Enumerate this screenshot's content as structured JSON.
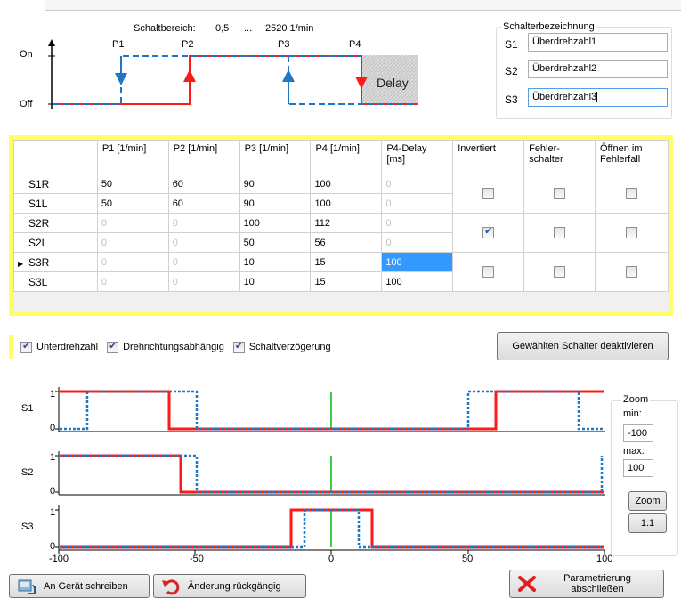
{
  "diagram": {
    "range_label": "Schaltbereich:",
    "range_min": "0,5",
    "range_sep": "...",
    "range_max": "2520 1/min",
    "on_label": "On",
    "off_label": "Off",
    "points": [
      "P1",
      "P2",
      "P3",
      "P4"
    ],
    "delay_label": "Delay"
  },
  "switch_names": {
    "title": "Schalterbezeichnung",
    "rows": [
      {
        "label": "S1",
        "value": "Überdrehzahl1"
      },
      {
        "label": "S2",
        "value": "Überdrehzahl2"
      },
      {
        "label": "S3",
        "value": "Überdrehzahl3"
      }
    ]
  },
  "grid": {
    "columns": [
      "",
      "P1 [1/min]",
      "P2 [1/min]",
      "P3 [1/min]",
      "P4 [1/min]",
      "P4-Delay [ms]",
      "Invertiert",
      "Fehler-schalter",
      "Öffnen im Fehlerfall"
    ],
    "rows": [
      {
        "name": "S1R",
        "p1": "50",
        "p2": "60",
        "p3": "90",
        "p4": "100",
        "delay": "0"
      },
      {
        "name": "S1L",
        "p1": "50",
        "p2": "60",
        "p3": "90",
        "p4": "100",
        "delay": "0"
      },
      {
        "name": "S2R",
        "p1": "0",
        "p2": "0",
        "p3": "100",
        "p4": "112",
        "delay": "0"
      },
      {
        "name": "S2L",
        "p1": "0",
        "p2": "0",
        "p3": "50",
        "p4": "56",
        "delay": "0"
      },
      {
        "name": "S3R",
        "p1": "0",
        "p2": "0",
        "p3": "10",
        "p4": "15",
        "delay": "100"
      },
      {
        "name": "S3L",
        "p1": "0",
        "p2": "0",
        "p3": "10",
        "p4": "15",
        "delay": "100"
      }
    ],
    "groups": [
      {
        "invertiert": false,
        "fehlerschalter": false,
        "oeffnen": false
      },
      {
        "invertiert": true,
        "fehlerschalter": false,
        "oeffnen": false
      },
      {
        "invertiert": false,
        "fehlerschalter": false,
        "oeffnen": false
      }
    ]
  },
  "options": {
    "unterdrehzahl": "Unterdrehzahl",
    "drehrichtung": "Drehrichtungsabhängig",
    "schaltverzoegerung": "Schaltverzögerung"
  },
  "deactivate_button": "Gewählten Schalter deaktivieren",
  "plots": {
    "rows": [
      "S1",
      "S2",
      "S3"
    ],
    "y_ticks": [
      "1",
      "0"
    ],
    "x_ticks": [
      "-100",
      "-50",
      "0",
      "50",
      "100"
    ],
    "xlim": [
      -100,
      100
    ]
  },
  "zoom": {
    "title": "Zoom",
    "min_label": "min:",
    "min_value": "-100",
    "max_label": "max:",
    "max_value": "100",
    "zoom_button": "Zoom",
    "reset_button": "1:1"
  },
  "bottom": {
    "write_button": "An Gerät schreiben",
    "undo_button": "Änderung rückgängig",
    "finish_button": "Parametrierung abschließen"
  },
  "colors": {
    "red": "#ff1a1a",
    "blue": "#1f77c8",
    "green": "#44cc44",
    "highlight": "#ffff66"
  }
}
